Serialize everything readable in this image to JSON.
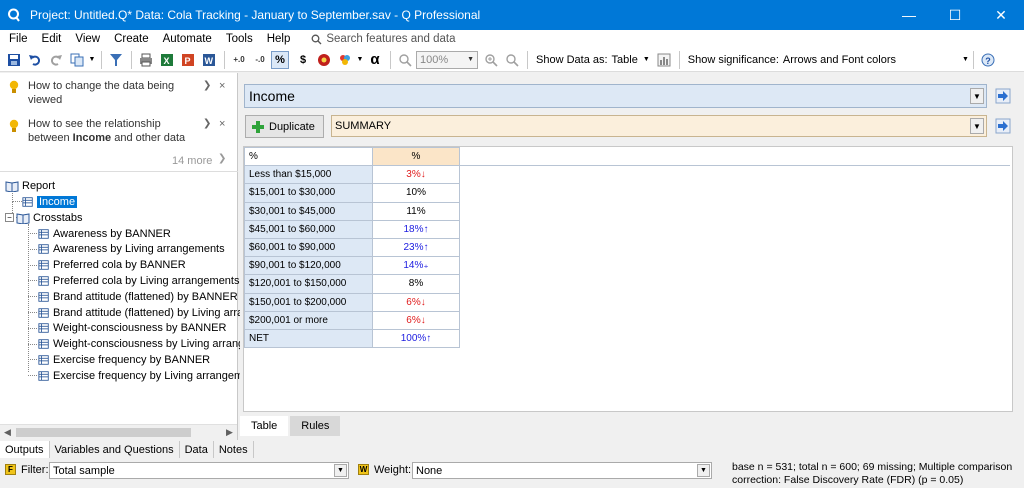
{
  "window": {
    "title": "Project: Untitled.Q*  Data: Cola Tracking - January to September.sav - Q Professional",
    "minimize_glyph": "—",
    "maximize_glyph": "☐",
    "close_glyph": "✕"
  },
  "menu": {
    "items": [
      "File",
      "Edit",
      "View",
      "Create",
      "Automate",
      "Tools",
      "Help"
    ],
    "search_placeholder": "Search features and data"
  },
  "toolbar": {
    "percent_label": "%",
    "dollar_label": "$",
    "alpha_label": "α",
    "zoom_value": "100%",
    "show_data_as_label": "Show Data as:",
    "show_data_as_value": "Table",
    "show_significance_label": "Show significance:",
    "show_significance_value": "Arrows and Font colors"
  },
  "tips": [
    {
      "text": "How to change the data being viewed"
    },
    {
      "text_pre": "How to see the relationship between ",
      "text_bold": "Income",
      "text_post": " and other data"
    }
  ],
  "more_label": "14 more",
  "tree": {
    "report": "Report",
    "income": "Income",
    "crosstabs": "Crosstabs",
    "children": [
      "Awareness by BANNER",
      "Awareness by Living arrangements",
      "Preferred cola by BANNER",
      "Preferred cola by Living arrangements",
      "Brand attitude (flattened) by BANNER",
      "Brand attitude (flattened) by Living arrangements",
      "Weight-consciousness by BANNER",
      "Weight-consciousness by Living arrangements",
      "Exercise frequency by BANNER",
      "Exercise frequency by Living arrangements"
    ]
  },
  "main": {
    "question": "Income",
    "duplicate_label": "Duplicate",
    "summary": "SUMMARY",
    "table": {
      "corner": "%",
      "column": "%",
      "rows": [
        {
          "label": "Less than $15,000",
          "value": "3%",
          "sig": "down"
        },
        {
          "label": "$15,001 to $30,000",
          "value": "10%",
          "sig": ""
        },
        {
          "label": "$30,001 to $45,000",
          "value": "11%",
          "sig": ""
        },
        {
          "label": "$45,001 to $60,000",
          "value": "18%",
          "sig": "up"
        },
        {
          "label": "$60,001 to $90,000",
          "value": "23%",
          "sig": "up"
        },
        {
          "label": "$90,001 to $120,000",
          "value": "14%",
          "sig": "up-color"
        },
        {
          "label": "$120,001 to $150,000",
          "value": "8%",
          "sig": ""
        },
        {
          "label": "$150,001 to $200,000",
          "value": "6%",
          "sig": "down"
        },
        {
          "label": "$200,001 or more",
          "value": "6%",
          "sig": "down"
        },
        {
          "label": "NET",
          "value": "100%",
          "sig": "up"
        }
      ]
    },
    "subtabs": [
      "Table",
      "Rules"
    ]
  },
  "bottom_tabs": [
    "Outputs",
    "Variables and Questions",
    "Data",
    "Notes"
  ],
  "filterbar": {
    "filter_badge": "F",
    "filter_label": "Filter:",
    "filter_value": "Total sample",
    "weight_badge": "W",
    "weight_label": "Weight:",
    "weight_value": "None",
    "status": "base n = 531; total n = 600; 69 missing; Multiple comparison correction: False Discovery Rate (FDR) (p = 0.05)"
  },
  "colors": {
    "titlebar": "#0078d7",
    "selection": "#0078d7",
    "sig_up": "#1c1ce0",
    "sig_down": "#e01c1c",
    "row_header_bg": "#dde8f5",
    "col_header_bg": "#fbe5c8"
  }
}
